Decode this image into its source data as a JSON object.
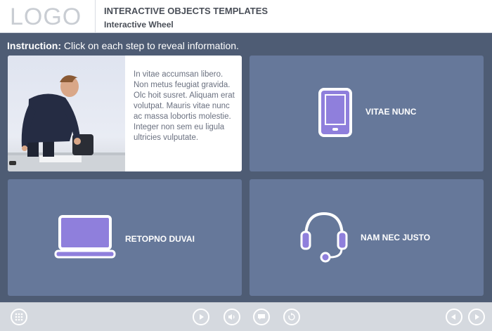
{
  "header": {
    "logo": "LOGO",
    "title": "INTERACTIVE OBJECTS TEMPLATES",
    "subtitle": "Interactive Wheel"
  },
  "instruction": {
    "label": "Instruction:",
    "text": " Click on each step to reveal information."
  },
  "cards": {
    "open_text": "In vitae accumsan libero. Non metus feugiat gravida. Olc hoit susret. Aliquam erat volutpat. Mauris vitae nunc ac massa lobortis molestie. Integer non sem eu ligula ultricies vulputate.",
    "card2": {
      "label": "VITAE NUNC",
      "icon": "tablet-icon"
    },
    "card3": {
      "label": "RETOPNO DUVAI",
      "icon": "laptop-icon"
    },
    "card4": {
      "label": "NAM NEC JUSTO",
      "icon": "headset-icon"
    }
  },
  "colors": {
    "background": "#4e5c74",
    "card": "#66789a",
    "icon_fill": "#8f7fdc",
    "toolbar": "#d5d9df"
  }
}
